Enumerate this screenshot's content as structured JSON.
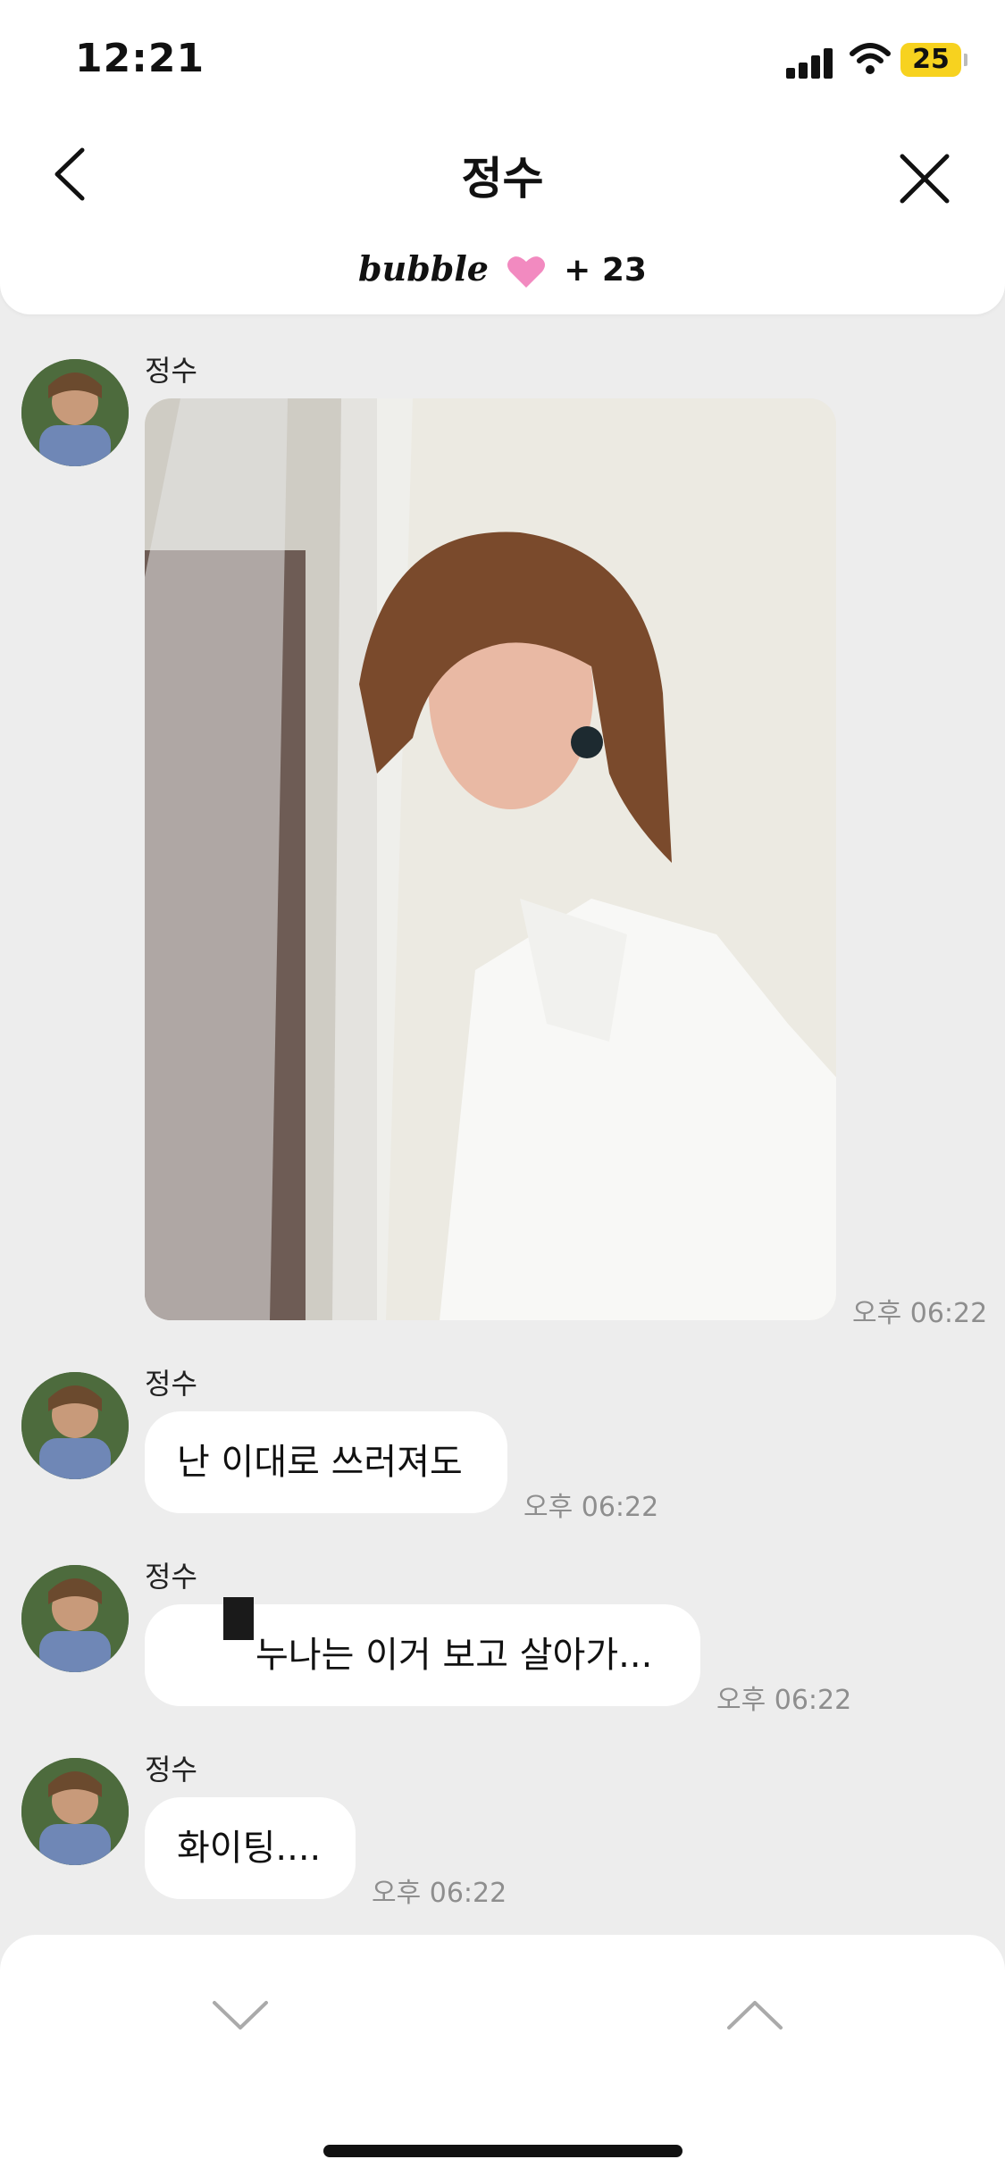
{
  "status_bar": {
    "time": "12:21",
    "battery": "25"
  },
  "header": {
    "title": "정수",
    "bubble_logo": "bubble",
    "bubble_count": "+ 23"
  },
  "colors": {
    "background": "#ededed",
    "header": "#ffffff",
    "battery": "#f7d21f",
    "heart": "#f28ac0"
  },
  "messages": [
    {
      "sender": "정수",
      "type": "image",
      "time": "오후 06:22"
    },
    {
      "sender": "정수",
      "type": "text",
      "text": "난 이대로 쓰러져도",
      "time": "오후 06:22"
    },
    {
      "sender": "정수",
      "type": "text",
      "text": "누나는 이거 보고 살아가...",
      "time": "오후 06:22"
    },
    {
      "sender": "정수",
      "type": "text",
      "text": "화이팅....",
      "time": "오후 06:22"
    }
  ],
  "icons": {
    "back": "chevron-left-icon",
    "close": "close-icon",
    "heart": "heart-icon",
    "scroll_down": "chevron-down-icon",
    "scroll_up": "chevron-up-icon"
  }
}
